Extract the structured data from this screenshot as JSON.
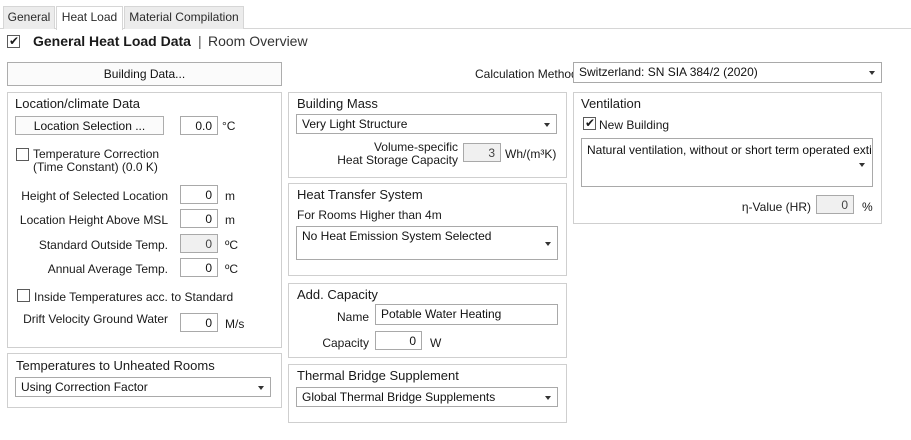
{
  "tabs": [
    {
      "label": "General"
    },
    {
      "label": "Heat Load"
    },
    {
      "label": "Material Compilation"
    }
  ],
  "header": {
    "title": "General Heat Load Data",
    "separator": "|",
    "subtitle": "Room Overview"
  },
  "building_data_button": "Building Data...",
  "calculation_method": {
    "label": "Calculation Method",
    "value": "Switzerland: SN SIA 384/2 (2020)"
  },
  "location": {
    "title": "Location/climate Data",
    "location_button": "Location Selection ...",
    "temperature_value": "0.0",
    "temperature_unit": "°C",
    "temp_correction_line1": "Temperature Correction",
    "temp_correction_line2": "(Time Constant) (0.0 K)",
    "height_label": "Height of Selected Location",
    "height_value": "0",
    "height_unit": "m",
    "msl_label": "Location Height Above MSL",
    "msl_value": "0",
    "msl_unit": "m",
    "std_outside_label": "Standard Outside Temp.",
    "std_outside_value": "0",
    "std_outside_unit": "ºC",
    "annual_avg_label": "Annual Average Temp.",
    "annual_avg_value": "0",
    "annual_avg_unit": "ºC",
    "inside_temps_label": "Inside Temperatures acc. to Standard",
    "drift_label": "Drift Velocity Ground Water",
    "drift_value": "0",
    "drift_unit": "M/s"
  },
  "unheated": {
    "title": "Temperatures to Unheated Rooms",
    "value": "Using Correction Factor"
  },
  "building_mass": {
    "title": "Building Mass",
    "value": "Very Light Structure",
    "vol_label_line1": "Volume-specific",
    "vol_label_line2": "Heat Storage Capacity",
    "vol_value": "3",
    "vol_unit": "Wh/(m³K)"
  },
  "heat_transfer": {
    "title": "Heat Transfer System",
    "subtitle": "For Rooms Higher than 4m",
    "value": "No Heat Emission System Selected"
  },
  "add_capacity": {
    "title": "Add. Capacity",
    "name_label": "Name",
    "name_value": "Potable Water Heating",
    "capacity_label": "Capacity",
    "capacity_value": "0",
    "capacity_unit": "W"
  },
  "thermal_bridge": {
    "title": "Thermal Bridge Supplement",
    "value": "Global Thermal Bridge Supplements"
  },
  "ventilation": {
    "title": "Ventilation",
    "new_building_label": "New Building",
    "new_building_checked": true,
    "value": "Natural ventilation, without or short term operated exti",
    "eta_label": "η-Value (HR)",
    "eta_value": "0",
    "eta_unit": "%"
  },
  "icons": {
    "check": "checkmark-icon",
    "dropdown": "chevron-down-icon"
  }
}
